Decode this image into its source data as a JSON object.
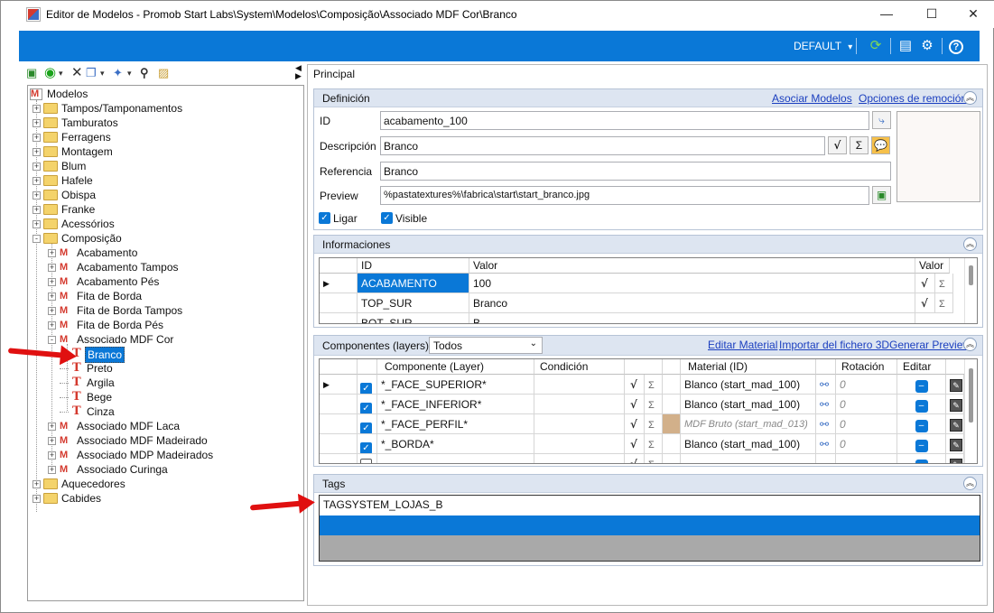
{
  "window": {
    "title": "Editor de Modelos - Promob Start Labs\\System\\Modelos\\Composição\\Associado MDF Cor\\Branco",
    "min": "—",
    "max": "☐",
    "close": "✕"
  },
  "toolbar": {
    "preset": "DEFAULT",
    "preset_arrow": "▾"
  },
  "tree": {
    "root": "Modelos",
    "items": [
      {
        "label": "Tampos/Tamponamentos"
      },
      {
        "label": "Tamburatos"
      },
      {
        "label": "Ferragens"
      },
      {
        "label": "Montagem"
      },
      {
        "label": "Blum"
      },
      {
        "label": "Hafele"
      },
      {
        "label": "Obispa"
      },
      {
        "label": "Franke"
      },
      {
        "label": "Acessórios"
      },
      {
        "label": "Composição"
      },
      {
        "label": "Acabamento"
      },
      {
        "label": "Acabamento Tampos"
      },
      {
        "label": "Acabamento Pés"
      },
      {
        "label": "Fita de Borda"
      },
      {
        "label": "Fita de Borda Tampos"
      },
      {
        "label": "Fita de Borda Pés"
      },
      {
        "label": "Associado MDF Cor"
      },
      {
        "label": "Branco"
      },
      {
        "label": "Preto"
      },
      {
        "label": "Argila"
      },
      {
        "label": "Bege"
      },
      {
        "label": "Cinza"
      },
      {
        "label": "Associado MDF Laca"
      },
      {
        "label": "Associado MDF Madeirado"
      },
      {
        "label": "Associado MDP Madeirados"
      },
      {
        "label": "Associado Curinga"
      },
      {
        "label": "Aquecedores"
      },
      {
        "label": "Cabides"
      }
    ]
  },
  "main": {
    "tab_title": "Principal",
    "definicion": {
      "header": "Definición",
      "link_asociar": "Asociar Modelos",
      "link_opciones": "Opciones de remoción",
      "id_label": "ID",
      "id_value": "acabamento_100",
      "desc_label": "Descripción",
      "desc_value": "Branco",
      "ref_label": "Referencia",
      "ref_value": "Branco",
      "preview_label": "Preview",
      "preview_value": "%pastatextures%\\fabrica\\start\\start_branco.jpg",
      "ligar_label": "Ligar",
      "visible_label": "Visible"
    },
    "informaciones": {
      "header": "Informaciones",
      "columns": [
        "ID",
        "Valor",
        "Valor"
      ],
      "rows": [
        {
          "id": "ACABAMENTO",
          "valor": "100"
        },
        {
          "id": "TOP_SUR",
          "valor": "Branco"
        },
        {
          "id": "BOT_SUR",
          "valor": "B..."
        }
      ]
    },
    "componentes": {
      "header": "Componentes (layers)",
      "filter_value": "Todos",
      "link_editar": "Editar Material",
      "link_importar": "Importar del fichero 3D",
      "link_generar": "Generar Preview",
      "columns": {
        "componente": "Componente (Layer)",
        "condicion": "Condición",
        "material": "Material (ID)",
        "rotacion": "Rotación",
        "editar": "Editar"
      },
      "rows": [
        {
          "componente": "*_FACE_SUPERIOR*",
          "material": "Blanco (start_mad_100)",
          "rotacion": "0"
        },
        {
          "componente": "*_FACE_INFERIOR*",
          "material": "Blanco (start_mad_100)",
          "rotacion": "0"
        },
        {
          "componente": "*_FACE_PERFIL*",
          "material": "MDF Bruto (start_mad_013)",
          "rotacion": "0"
        },
        {
          "componente": "*_BORDA*",
          "material": "Blanco (start_mad_100)",
          "rotacion": "0"
        }
      ]
    },
    "tags": {
      "header": "Tags",
      "value": "TAGSYSTEM_LOJAS_B"
    }
  },
  "colors": {
    "accent": "#0a78d7",
    "panel_header": "#dde5f1",
    "arrow": "#e01010"
  }
}
